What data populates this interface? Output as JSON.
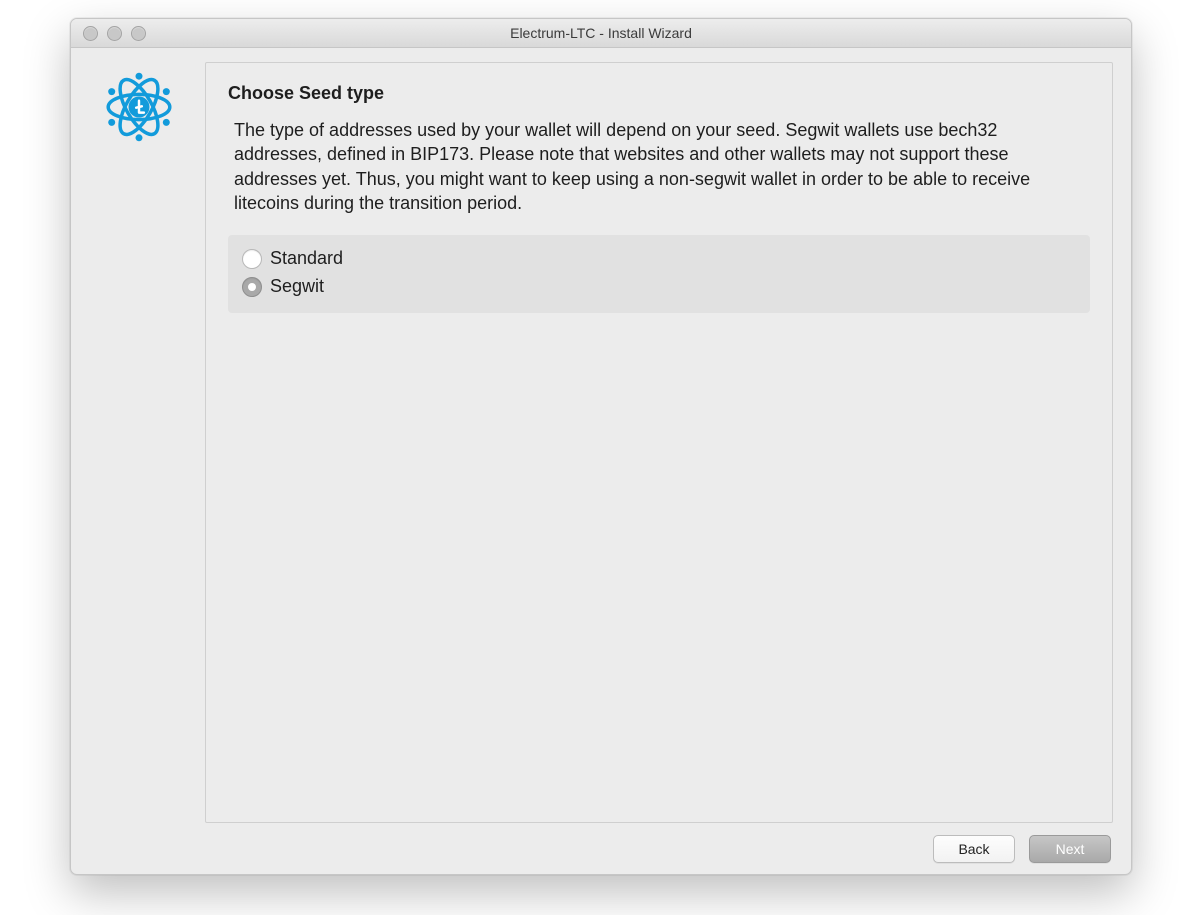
{
  "window": {
    "title": "Electrum-LTC  -  Install Wizard"
  },
  "content": {
    "heading": "Choose Seed type",
    "description": "The type of addresses used by your wallet will depend on your seed. Segwit wallets use bech32 addresses, defined in BIP173. Please note that websites and other wallets may not support these addresses yet. Thus, you might want to keep using a non-segwit wallet in order to be able to receive litecoins during the transition period.",
    "options": [
      {
        "label": "Standard",
        "checked": false
      },
      {
        "label": "Segwit",
        "checked": true
      }
    ]
  },
  "buttons": {
    "back": "Back",
    "next": "Next"
  },
  "colors": {
    "icon_blue": "#129bdb"
  }
}
